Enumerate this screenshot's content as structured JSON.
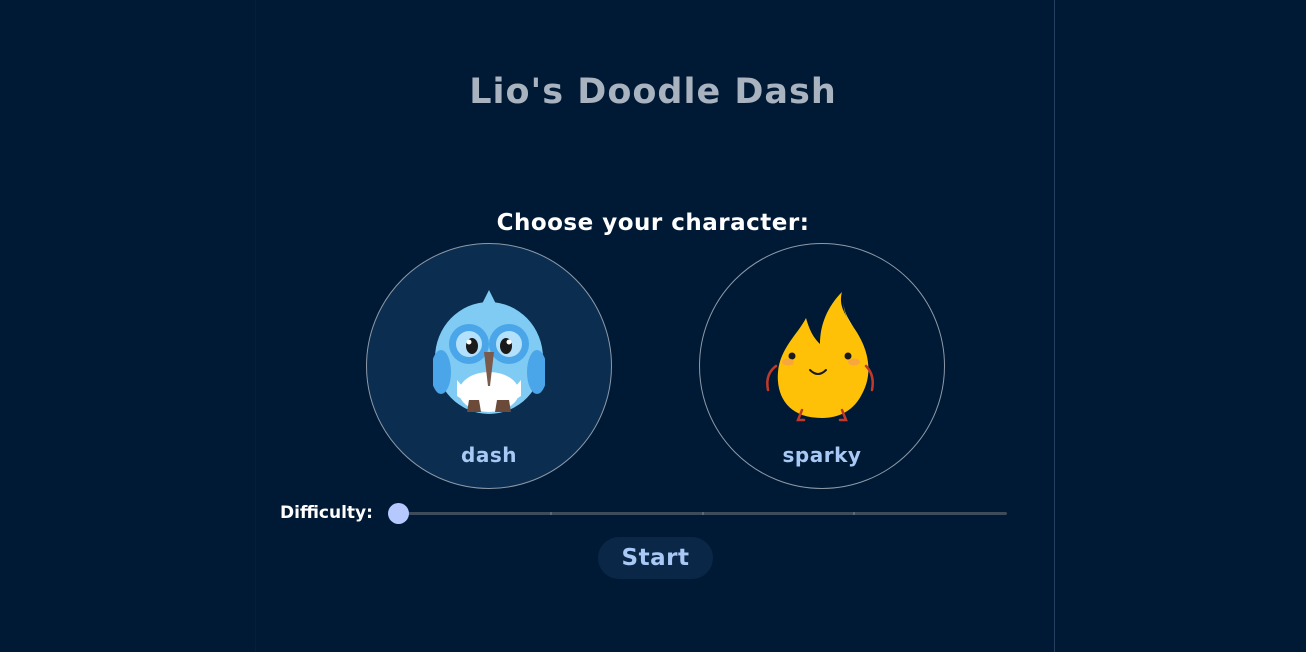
{
  "game": {
    "title": "Lio's Doodle Dash"
  },
  "character_select": {
    "label": "Choose your character:",
    "options": [
      {
        "name": "dash",
        "icon": "blue-owl-icon",
        "selected": true
      },
      {
        "name": "sparky",
        "icon": "flame-character-icon",
        "selected": false
      }
    ]
  },
  "difficulty": {
    "label": "Difficulty:",
    "value_fraction": 0,
    "ticks": 5
  },
  "start": {
    "label": "Start"
  },
  "colors": {
    "background": "#001a35",
    "accent": "#a8c8f5",
    "slider_thumb": "#b5c9ff",
    "selected_bg": "#0b2e50"
  }
}
